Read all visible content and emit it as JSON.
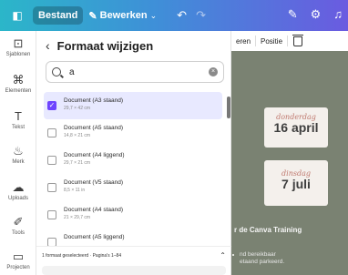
{
  "topbar": {
    "file_label": "Bestand",
    "edit_label": "Bewerken",
    "edit_chevron": "⌄",
    "undo": "↶",
    "redo": "↷",
    "right_icons": [
      "✎",
      "⚙",
      "♫"
    ]
  },
  "rail": [
    {
      "icon": "template-icon",
      "glyph": "⊡",
      "label": "Sjablonen"
    },
    {
      "icon": "elements-icon",
      "glyph": "⌘",
      "label": "Elementen"
    },
    {
      "icon": "text-icon",
      "glyph": "T",
      "label": "Tekst"
    },
    {
      "icon": "brand-icon",
      "glyph": "♨",
      "label": "Merk"
    },
    {
      "icon": "uploads-icon",
      "glyph": "☁",
      "label": "Uploads"
    },
    {
      "icon": "tools-icon",
      "glyph": "✐",
      "label": "Tools"
    },
    {
      "icon": "projects-icon",
      "glyph": "▭",
      "label": "Projecten"
    }
  ],
  "panel": {
    "back": "‹",
    "title": "Formaat wijzigen",
    "search_value": "a",
    "clear": "×",
    "items": [
      {
        "name": "Document (A3 staand)",
        "size": "29,7 × 42 cm",
        "checked": true
      },
      {
        "name": "Document (A5 staand)",
        "size": "14,8 × 21 cm",
        "checked": false
      },
      {
        "name": "Document (A4 liggend)",
        "size": "29,7 × 21 cm",
        "checked": false
      },
      {
        "name": "Document (V5 staand)",
        "size": "8,5 × 11 in",
        "checked": false
      },
      {
        "name": "Document (A4 staand)",
        "size": "21 × 29,7 cm",
        "checked": false
      },
      {
        "name": "Document (A5 liggend)",
        "size": "",
        "checked": false
      }
    ],
    "footer_status": "1 formaat geselecteerd · Pagina's 1–84",
    "footer_chevron": "⌃"
  },
  "canvas": {
    "toolbar": {
      "reorder_label": "eren",
      "position_label": "Positie"
    },
    "card1": {
      "script": "donderdag",
      "date": "16 april"
    },
    "card2": {
      "script": "dinsdag",
      "date": "7 juli"
    },
    "heading": "r de Canva Training",
    "sub_line1": "nd bereikbaar",
    "sub_line2": "etaand parkeerd."
  }
}
